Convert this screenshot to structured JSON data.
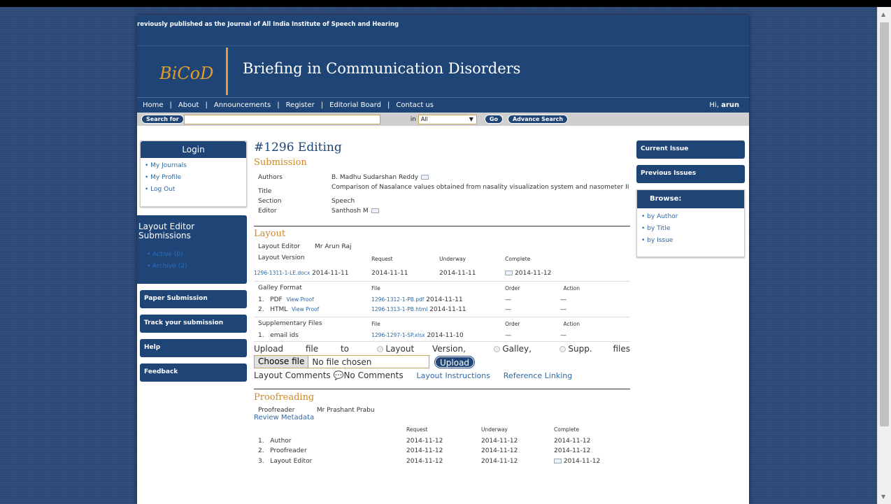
{
  "header": {
    "tagline": "reviously published as the Journal of All India Institute of Speech and Hearing",
    "logo": "BiCoD",
    "site_title": "Briefing in Communication Disorders"
  },
  "nav": {
    "items": [
      "Home",
      "About",
      "Announcements",
      "Register",
      "Editorial Board",
      "Contact us"
    ],
    "greeting": "Hi,",
    "user": "arun"
  },
  "search": {
    "search_label": "Search",
    "for_label": "for",
    "value": "",
    "in_label": "in",
    "scope": "All",
    "go": "Go",
    "advanced": "Advance Search"
  },
  "left_sidebar": {
    "login_title": "Login",
    "login_links": [
      "My Journals",
      "My Profile",
      "Log Out"
    ],
    "layout_editor_title": "Layout Editor Submissions",
    "le_links": [
      "Active (0)",
      "Archive (2)"
    ],
    "buttons": [
      "Paper Submission",
      "Track your submission",
      "Help",
      "Feedback"
    ]
  },
  "main": {
    "title": "#1296 Editing",
    "submission": {
      "heading": "Submission",
      "authors_label": "Authors",
      "authors": "B. Madhu Sudarshan Reddy",
      "title_label": "Title",
      "title": "Comparison of Nasalance values obtained from nasality visualization system and nasometer II",
      "section_label": "Section",
      "section": "Speech",
      "editor_label": "Editor",
      "editor": "Santhosh M"
    },
    "layout": {
      "heading": "Layout",
      "editor_label": "Layout Editor",
      "editor": "Mr Arun Raj",
      "version_label": "Layout Version",
      "col_request": "Request",
      "col_underway": "Underway",
      "col_complete": "Complete",
      "version_file": "1296-1311-1-LE.docx",
      "version_date": "2014-11-11",
      "version_request": "2014-11-11",
      "version_underway": "2014-11-11",
      "version_complete": "2014-11-12",
      "galley_label": "Galley Format",
      "col_file": "File",
      "col_order": "Order",
      "col_action": "Action",
      "galleys": [
        {
          "num": "1.",
          "fmt": "PDF",
          "proof": "View Proof",
          "file": "1296-1312-1-PB.pdf",
          "date": "2014-11-11",
          "order": "—",
          "action": "—"
        },
        {
          "num": "2.",
          "fmt": "HTML",
          "proof": "View Proof",
          "file": "1296-1313-1-PB.html",
          "date": "2014-11-11",
          "order": "—",
          "action": "—"
        }
      ],
      "supp_label": "Supplementary Files",
      "supp": [
        {
          "num": "1.",
          "name": "email ids",
          "file": "1296-1297-1-SP.xlsx",
          "date": "2014-11-10",
          "order": "—",
          "action": "—"
        }
      ],
      "upload_prefix": "Upload file to",
      "opt_layout": "Layout Version,",
      "opt_galley": "Galley,",
      "opt_supp": "Supp. files",
      "choose_file": "Choose file",
      "no_file": "No file chosen",
      "upload_button": "Upload",
      "comments_label": "Layout Comments",
      "no_comments": "No Comments",
      "instructions": "Layout Instructions",
      "reference": "Reference Linking"
    },
    "proofreading": {
      "heading": "Proofreading",
      "proofreader_label": "Proofreader",
      "proofreader": "Mr Prashant Prabu",
      "review_metadata": "Review Metadata",
      "col_request": "Request",
      "col_underway": "Underway",
      "col_complete": "Complete",
      "rows": [
        {
          "num": "1.",
          "role": "Author",
          "request": "2014-11-12",
          "underway": "2014-11-12",
          "complete": "2014-11-12"
        },
        {
          "num": "2.",
          "role": "Proofreader",
          "request": "2014-11-12",
          "underway": "2014-11-12",
          "complete": "2014-11-12"
        },
        {
          "num": "3.",
          "role": "Layout Editor",
          "request": "2014-11-12",
          "underway": "2014-11-12",
          "complete": "2014-11-12"
        }
      ]
    }
  },
  "right_sidebar": {
    "current_issue": "Current Issue",
    "previous_issues": "Previous Issues",
    "browse_title": "Browse:",
    "browse_links": [
      "by Author",
      "by Title",
      "by Issue"
    ]
  },
  "colors": {
    "brand_navy": "#1f4476",
    "accent_orange": "#e29c2e",
    "link_blue": "#2e68a8"
  }
}
